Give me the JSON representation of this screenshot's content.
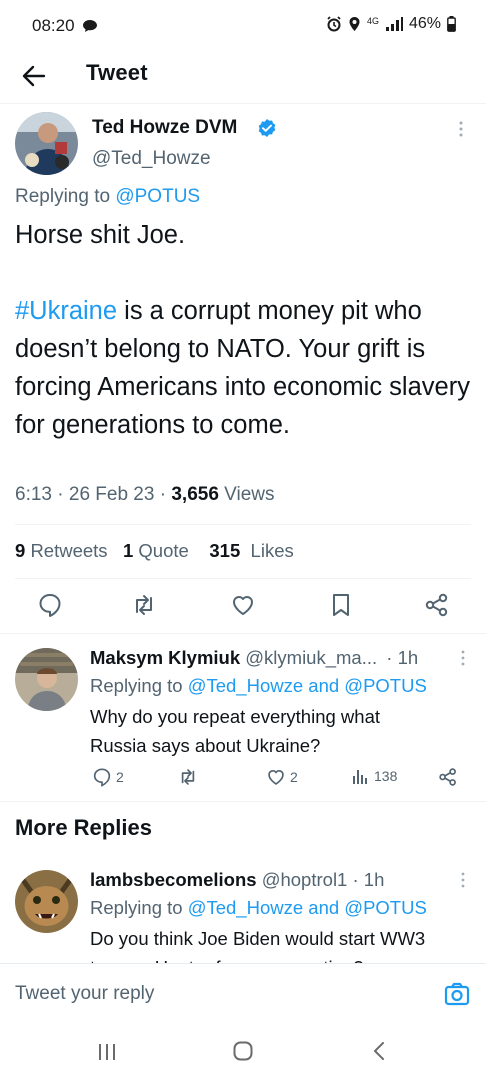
{
  "status_bar": {
    "time": "08:20",
    "network": "4G",
    "battery": "46%"
  },
  "header": {
    "title": "Tweet"
  },
  "tweet": {
    "author_name": "Ted Howze DVM",
    "handle": "@Ted_Howze",
    "replying_label": "Replying to",
    "replying_to": "@POTUS",
    "line1": "Horse shit Joe.",
    "hashtag": "#Ukraine",
    "body_rest": " is a corrupt money pit who doesn’t belong to NATO. Your grift is forcing Americans into economic slavery for generations to come.",
    "time": "6:13",
    "date": "26 Feb 23",
    "views_count": "3,656",
    "views_label": "Views",
    "retweets_count": "9",
    "retweets_label": "Retweets",
    "quotes_count": "1",
    "quotes_label": "Quote",
    "likes_count": "315",
    "likes_label": "Likes"
  },
  "replies": [
    {
      "name": "Maksym Klymiuk",
      "handle": "@klymiuk_ma...",
      "age": "· 1h",
      "replying_label": "Replying to",
      "replying_to": "@Ted_Howze and @POTUS",
      "text": "Why do you repeat everything what Russia says about Ukraine?",
      "reply_count": "2",
      "like_count": "2",
      "view_count": "138"
    }
  ],
  "more_replies": {
    "title": "More Replies",
    "items": [
      {
        "name": "lambsbecomelions",
        "handle": "@hoptrol1",
        "age": "· 1h",
        "replying_label": "Replying to",
        "replying_to": "@Ted_Howze and @POTUS",
        "text_line1": "Do you think Joe Biden would start WW3",
        "text_line2": "to save Hunter from prosecution?"
      }
    ]
  },
  "composer": {
    "placeholder": "Tweet your reply"
  },
  "colors": {
    "accent": "#1d9bf0",
    "secondary_text": "#536471",
    "primary_text": "#0f1419"
  }
}
